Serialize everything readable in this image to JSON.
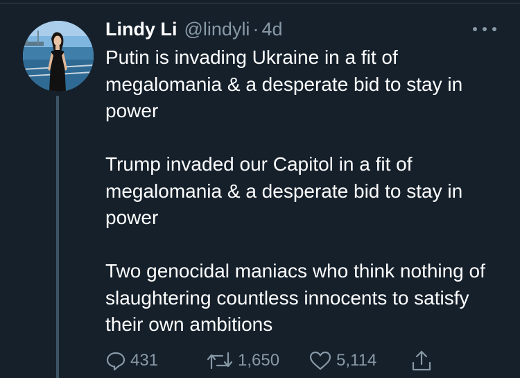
{
  "tweet": {
    "author_name": "Lindy Li",
    "author_handle": "@lindyli",
    "separator": "·",
    "time": "4d",
    "paragraphs": [
      "Putin is invading Ukraine in a fit of megalomania & a desperate bid to stay in power",
      "Trump invaded our Capitol in a fit of megalomania & a desperate bid to stay in power",
      "Two genocidal maniacs who think nothing of slaughtering countless innocents to satisfy their own ambitions"
    ],
    "replies": "431",
    "retweets": "1,650",
    "likes": "5,114"
  },
  "icons": {
    "more": "more-horizontal-icon",
    "reply": "reply-icon",
    "retweet": "retweet-icon",
    "like": "heart-icon",
    "share": "share-icon"
  },
  "colors": {
    "background": "#15202b",
    "text": "#ffffff",
    "secondary": "#8899a6",
    "divider": "#38444d",
    "thread_line": "#3d5466"
  }
}
